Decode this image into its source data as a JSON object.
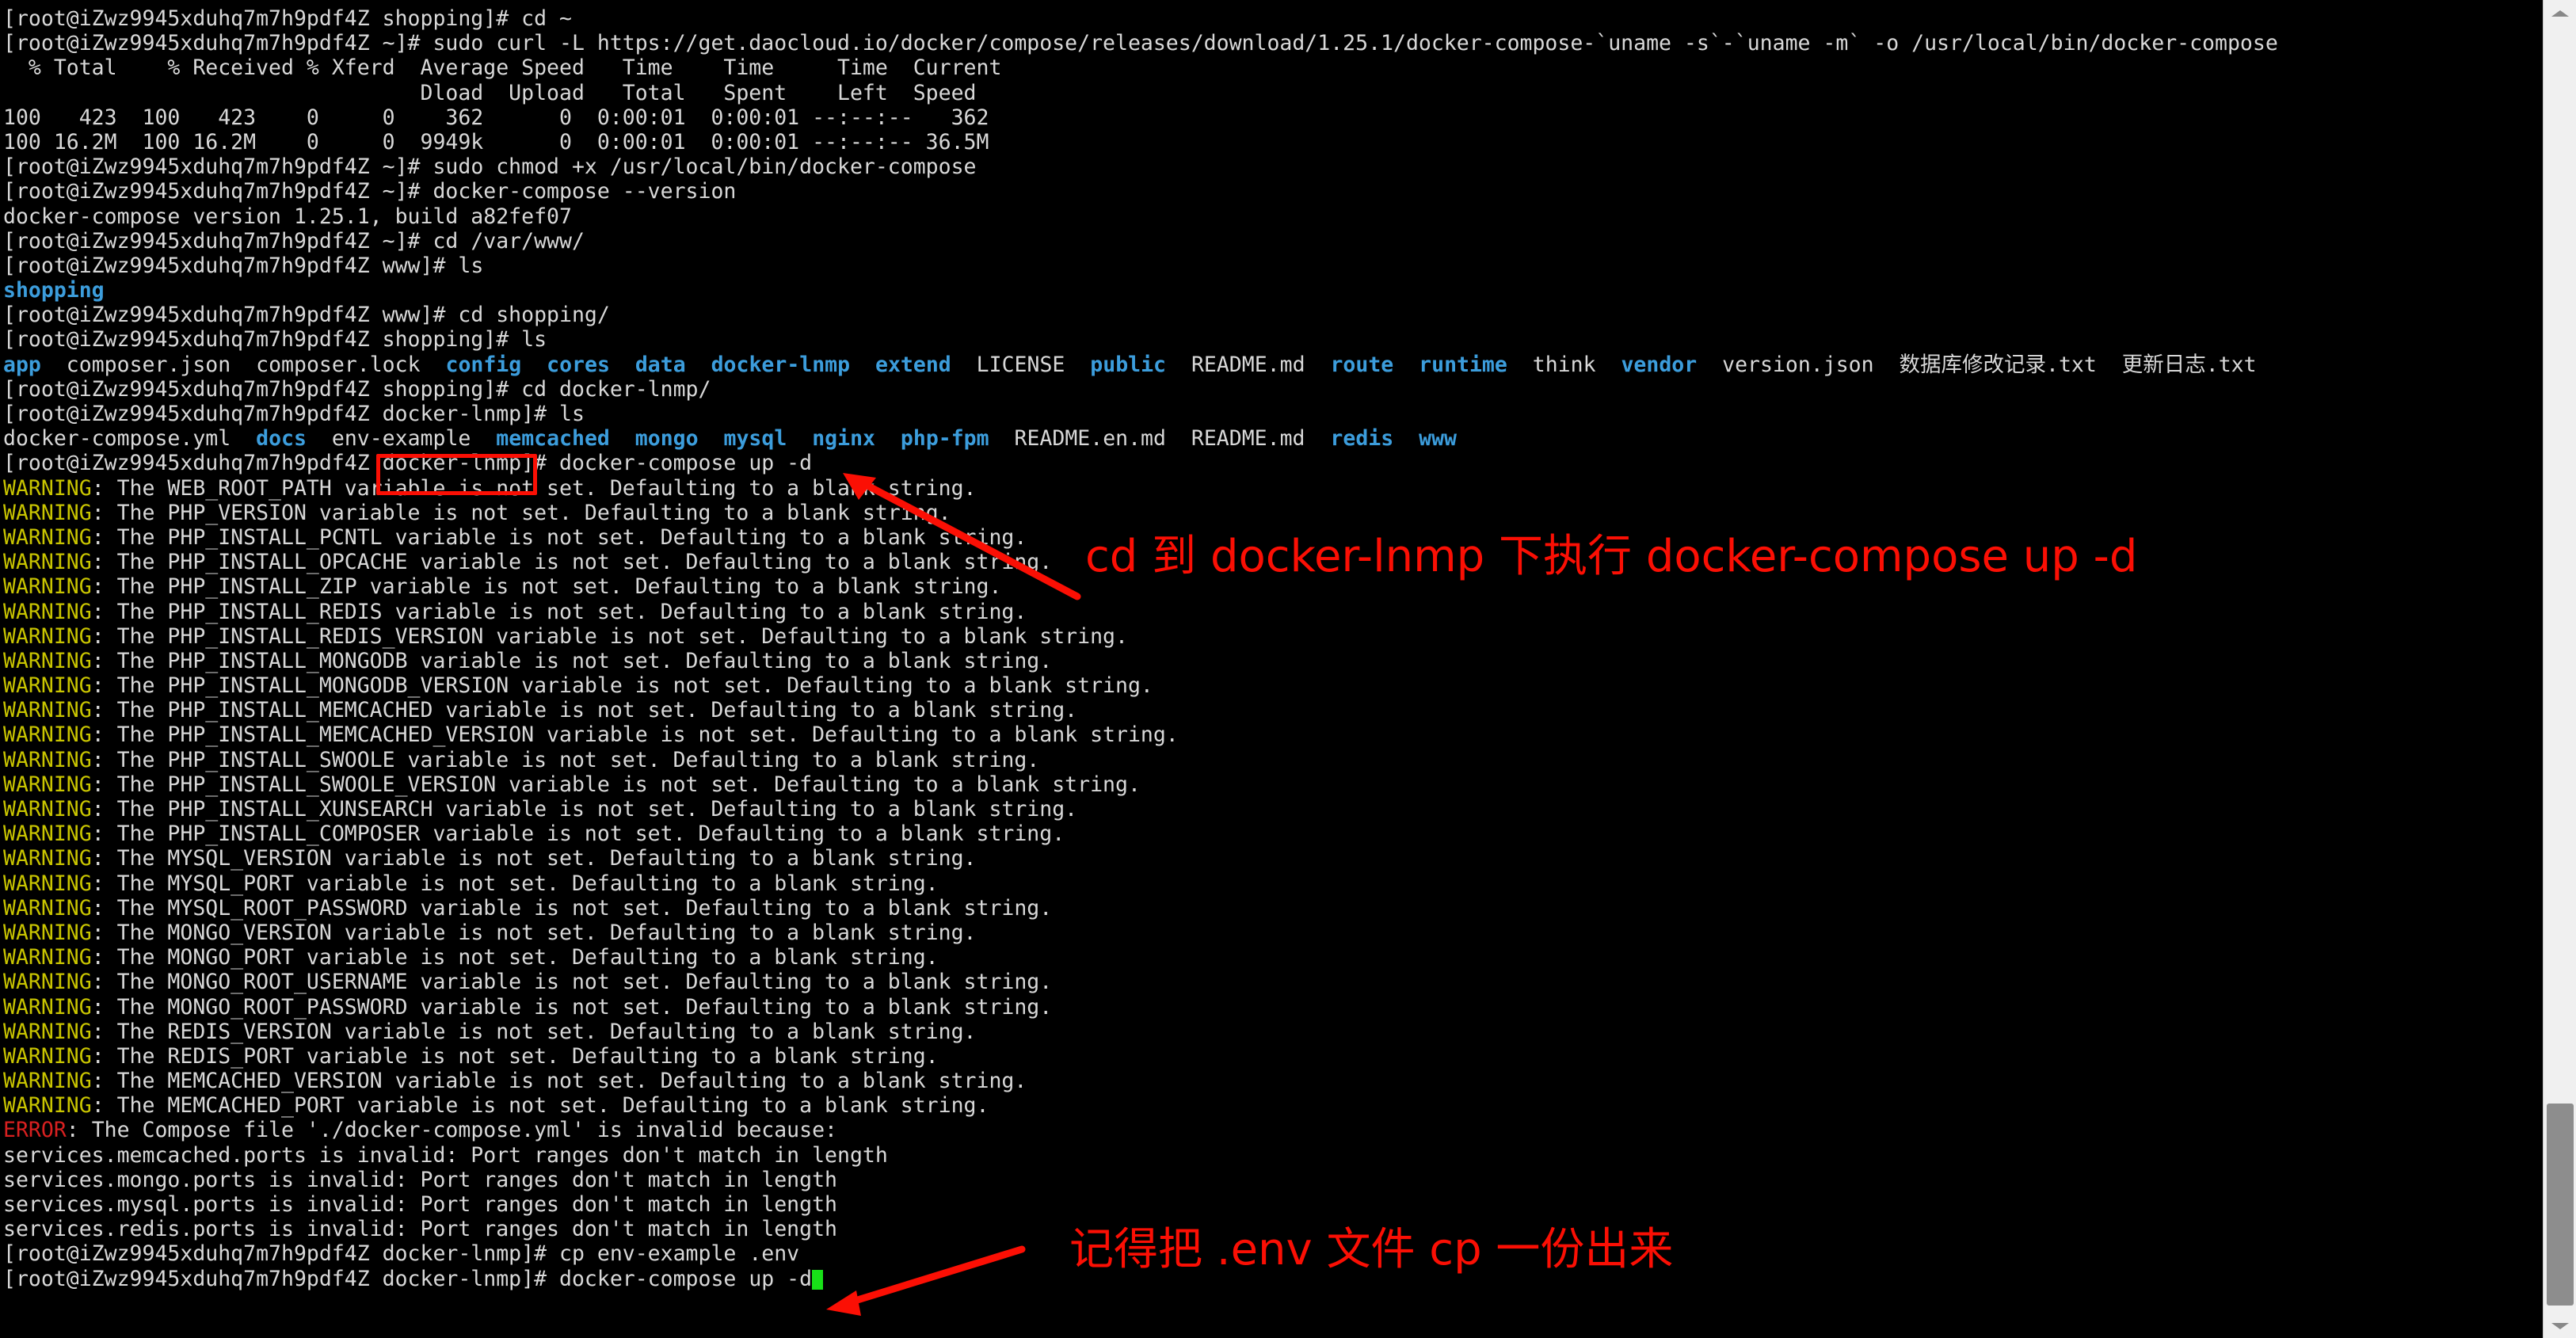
{
  "terminal": {
    "prompt_user_host": "[root@iZwz9945xduhq7m7h9pdf4Z",
    "lines": [
      {
        "id": "l01",
        "kind": "prompt",
        "prompt": "[root@iZwz9945xduhq7m7h9pdf4Z shopping]# ",
        "command": "cd ~"
      },
      {
        "id": "l02",
        "kind": "prompt",
        "prompt": "[root@iZwz9945xduhq7m7h9pdf4Z ~]# ",
        "command": "sudo curl -L https://get.daocloud.io/docker/compose/releases/download/1.25.1/docker-compose-`uname -s`-`uname -m` -o /usr/local/bin/docker-compose"
      },
      {
        "id": "l03",
        "kind": "plain",
        "text": "  % Total    % Received % Xferd  Average Speed   Time    Time     Time  Current"
      },
      {
        "id": "l04",
        "kind": "plain",
        "text": "                                 Dload  Upload   Total   Spent    Left  Speed"
      },
      {
        "id": "l05",
        "kind": "plain",
        "text": "100   423  100   423    0     0    362      0  0:00:01  0:00:01 --:--:--   362"
      },
      {
        "id": "l06",
        "kind": "plain",
        "text": "100 16.2M  100 16.2M    0     0  9949k      0  0:00:01  0:00:01 --:--:-- 36.5M"
      },
      {
        "id": "l07",
        "kind": "prompt",
        "prompt": "[root@iZwz9945xduhq7m7h9pdf4Z ~]# ",
        "command": "sudo chmod +x /usr/local/bin/docker-compose"
      },
      {
        "id": "l08",
        "kind": "prompt",
        "prompt": "[root@iZwz9945xduhq7m7h9pdf4Z ~]# ",
        "command": "docker-compose --version"
      },
      {
        "id": "l09",
        "kind": "plain",
        "text": "docker-compose version 1.25.1, build a82fef07"
      },
      {
        "id": "l10",
        "kind": "prompt",
        "prompt": "[root@iZwz9945xduhq7m7h9pdf4Z ~]# ",
        "command": "cd /var/www/"
      },
      {
        "id": "l11",
        "kind": "prompt",
        "prompt": "[root@iZwz9945xduhq7m7h9pdf4Z www]# ",
        "command": "ls"
      },
      {
        "id": "l12",
        "kind": "ls",
        "entries": [
          {
            "name": "shopping",
            "type": "dir"
          }
        ]
      },
      {
        "id": "l13",
        "kind": "prompt",
        "prompt": "[root@iZwz9945xduhq7m7h9pdf4Z www]# ",
        "command": "cd shopping/"
      },
      {
        "id": "l14",
        "kind": "prompt",
        "prompt": "[root@iZwz9945xduhq7m7h9pdf4Z shopping]# ",
        "command": "ls"
      },
      {
        "id": "l15",
        "kind": "ls",
        "entries": [
          {
            "name": "app",
            "type": "dir"
          },
          {
            "name": "composer.json",
            "type": "file"
          },
          {
            "name": "composer.lock",
            "type": "file"
          },
          {
            "name": "config",
            "type": "dir"
          },
          {
            "name": "cores",
            "type": "dir"
          },
          {
            "name": "data",
            "type": "dir"
          },
          {
            "name": "docker-lnmp",
            "type": "dir"
          },
          {
            "name": "extend",
            "type": "dir"
          },
          {
            "name": "LICENSE",
            "type": "file"
          },
          {
            "name": "public",
            "type": "dir"
          },
          {
            "name": "README.md",
            "type": "file"
          },
          {
            "name": "route",
            "type": "dir"
          },
          {
            "name": "runtime",
            "type": "dir"
          },
          {
            "name": "think",
            "type": "file"
          },
          {
            "name": "vendor",
            "type": "dir"
          },
          {
            "name": "version.json",
            "type": "file"
          },
          {
            "name": "数据库修改记录.txt",
            "type": "file"
          },
          {
            "name": "更新日志.txt",
            "type": "file"
          }
        ]
      },
      {
        "id": "l16",
        "kind": "prompt",
        "prompt": "[root@iZwz9945xduhq7m7h9pdf4Z shopping]# ",
        "command": "cd docker-lnmp/"
      },
      {
        "id": "l17",
        "kind": "prompt",
        "prompt": "[root@iZwz9945xduhq7m7h9pdf4Z docker-lnmp]# ",
        "command": "ls"
      },
      {
        "id": "l18",
        "kind": "ls",
        "entries": [
          {
            "name": "docker-compose.yml",
            "type": "file"
          },
          {
            "name": "docs",
            "type": "dir"
          },
          {
            "name": "env-example",
            "type": "file"
          },
          {
            "name": "memcached",
            "type": "dir"
          },
          {
            "name": "mongo",
            "type": "dir"
          },
          {
            "name": "mysql",
            "type": "dir"
          },
          {
            "name": "nginx",
            "type": "dir"
          },
          {
            "name": "php-fpm",
            "type": "dir"
          },
          {
            "name": "README.en.md",
            "type": "file"
          },
          {
            "name": "README.md",
            "type": "file"
          },
          {
            "name": "redis",
            "type": "dir"
          },
          {
            "name": "www",
            "type": "dir"
          }
        ]
      },
      {
        "id": "l19",
        "kind": "prompt",
        "prompt": "[root@iZwz9945xduhq7m7h9pdf4Z docker-lnmp]# ",
        "command": "docker-compose up -d"
      },
      {
        "id": "w01",
        "kind": "warning",
        "label": "WARNING",
        "text": ": The WEB_ROOT_PATH variable is not set. Defaulting to a blank string."
      },
      {
        "id": "w02",
        "kind": "warning",
        "label": "WARNING",
        "text": ": The PHP_VERSION variable is not set. Defaulting to a blank string."
      },
      {
        "id": "w03",
        "kind": "warning",
        "label": "WARNING",
        "text": ": The PHP_INSTALL_PCNTL variable is not set. Defaulting to a blank string."
      },
      {
        "id": "w04",
        "kind": "warning",
        "label": "WARNING",
        "text": ": The PHP_INSTALL_OPCACHE variable is not set. Defaulting to a blank string."
      },
      {
        "id": "w05",
        "kind": "warning",
        "label": "WARNING",
        "text": ": The PHP_INSTALL_ZIP variable is not set. Defaulting to a blank string."
      },
      {
        "id": "w06",
        "kind": "warning",
        "label": "WARNING",
        "text": ": The PHP_INSTALL_REDIS variable is not set. Defaulting to a blank string."
      },
      {
        "id": "w07",
        "kind": "warning",
        "label": "WARNING",
        "text": ": The PHP_INSTALL_REDIS_VERSION variable is not set. Defaulting to a blank string."
      },
      {
        "id": "w08",
        "kind": "warning",
        "label": "WARNING",
        "text": ": The PHP_INSTALL_MONGODB variable is not set. Defaulting to a blank string."
      },
      {
        "id": "w09",
        "kind": "warning",
        "label": "WARNING",
        "text": ": The PHP_INSTALL_MONGODB_VERSION variable is not set. Defaulting to a blank string."
      },
      {
        "id": "w10",
        "kind": "warning",
        "label": "WARNING",
        "text": ": The PHP_INSTALL_MEMCACHED variable is not set. Defaulting to a blank string."
      },
      {
        "id": "w11",
        "kind": "warning",
        "label": "WARNING",
        "text": ": The PHP_INSTALL_MEMCACHED_VERSION variable is not set. Defaulting to a blank string."
      },
      {
        "id": "w12",
        "kind": "warning",
        "label": "WARNING",
        "text": ": The PHP_INSTALL_SWOOLE variable is not set. Defaulting to a blank string."
      },
      {
        "id": "w13",
        "kind": "warning",
        "label": "WARNING",
        "text": ": The PHP_INSTALL_SWOOLE_VERSION variable is not set. Defaulting to a blank string."
      },
      {
        "id": "w14",
        "kind": "warning",
        "label": "WARNING",
        "text": ": The PHP_INSTALL_XUNSEARCH variable is not set. Defaulting to a blank string."
      },
      {
        "id": "w15",
        "kind": "warning",
        "label": "WARNING",
        "text": ": The PHP_INSTALL_COMPOSER variable is not set. Defaulting to a blank string."
      },
      {
        "id": "w16",
        "kind": "warning",
        "label": "WARNING",
        "text": ": The MYSQL_VERSION variable is not set. Defaulting to a blank string."
      },
      {
        "id": "w17",
        "kind": "warning",
        "label": "WARNING",
        "text": ": The MYSQL_PORT variable is not set. Defaulting to a blank string."
      },
      {
        "id": "w18",
        "kind": "warning",
        "label": "WARNING",
        "text": ": The MYSQL_ROOT_PASSWORD variable is not set. Defaulting to a blank string."
      },
      {
        "id": "w19",
        "kind": "warning",
        "label": "WARNING",
        "text": ": The MONGO_VERSION variable is not set. Defaulting to a blank string."
      },
      {
        "id": "w20",
        "kind": "warning",
        "label": "WARNING",
        "text": ": The MONGO_PORT variable is not set. Defaulting to a blank string."
      },
      {
        "id": "w21",
        "kind": "warning",
        "label": "WARNING",
        "text": ": The MONGO_ROOT_USERNAME variable is not set. Defaulting to a blank string."
      },
      {
        "id": "w22",
        "kind": "warning",
        "label": "WARNING",
        "text": ": The MONGO_ROOT_PASSWORD variable is not set. Defaulting to a blank string."
      },
      {
        "id": "w23",
        "kind": "warning",
        "label": "WARNING",
        "text": ": The REDIS_VERSION variable is not set. Defaulting to a blank string."
      },
      {
        "id": "w24",
        "kind": "warning",
        "label": "WARNING",
        "text": ": The REDIS_PORT variable is not set. Defaulting to a blank string."
      },
      {
        "id": "w25",
        "kind": "warning",
        "label": "WARNING",
        "text": ": The MEMCACHED_VERSION variable is not set. Defaulting to a blank string."
      },
      {
        "id": "w26",
        "kind": "warning",
        "label": "WARNING",
        "text": ": The MEMCACHED_PORT variable is not set. Defaulting to a blank string."
      },
      {
        "id": "e01",
        "kind": "error",
        "label": "ERROR",
        "text": ": The Compose file './docker-compose.yml' is invalid because:"
      },
      {
        "id": "e02",
        "kind": "plain",
        "text": "services.memcached.ports is invalid: Port ranges don't match in length"
      },
      {
        "id": "e03",
        "kind": "plain",
        "text": "services.mongo.ports is invalid: Port ranges don't match in length"
      },
      {
        "id": "e04",
        "kind": "plain",
        "text": "services.mysql.ports is invalid: Port ranges don't match in length"
      },
      {
        "id": "e05",
        "kind": "plain",
        "text": "services.redis.ports is invalid: Port ranges don't match in length"
      },
      {
        "id": "l20",
        "kind": "prompt",
        "prompt": "[root@iZwz9945xduhq7m7h9pdf4Z docker-lnmp]# ",
        "command": "cp env-example .env"
      },
      {
        "id": "l21",
        "kind": "prompt-cursor",
        "prompt": "[root@iZwz9945xduhq7m7h9pdf4Z docker-lnmp]# ",
        "command": "docker-compose up -d"
      }
    ]
  },
  "annotations": {
    "color": "#fb0f04",
    "note_1": "cd 到 docker-lnmp 下执行 docker-compose up -d",
    "note_2": "记得把 .env 文件 cp 一份出来",
    "highlight_box_label": "docker-lnmp"
  },
  "colors": {
    "background": "#000000",
    "foreground": "#d8d8d8",
    "directory": "#3c9ddc",
    "warning": "#c9c500",
    "error": "#d82020",
    "annotation": "#fb0f04",
    "cursor": "#18e018"
  },
  "scrollbar": {
    "up_arrow": "scroll-up-arrow",
    "down_arrow": "scroll-down-arrow"
  }
}
